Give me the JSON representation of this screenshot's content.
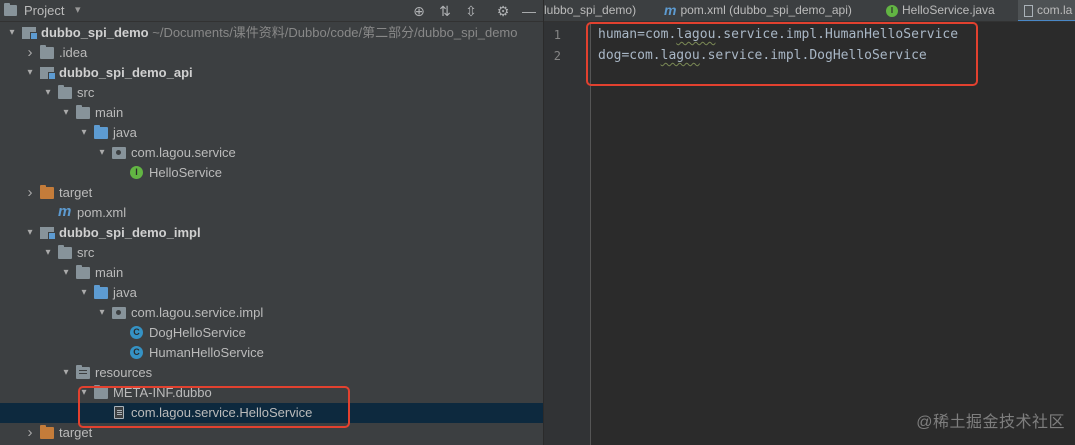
{
  "project_panel": {
    "title": "Project",
    "caret": "▾",
    "tools": [
      "⊕",
      "⇅",
      "⇳",
      "⚙",
      "—"
    ]
  },
  "tree": [
    {
      "key": "root",
      "label": "dubbo_spi_demo",
      "path": " ~/Documents/课件资料/Dubbo/code/第二部分/dubbo_spi_demo",
      "arrow": "▾",
      "icon": "module",
      "bold": true
    },
    {
      "key": "idea",
      "label": ".idea",
      "arrow": "›",
      "icon": "folder"
    },
    {
      "key": "api",
      "label": "dubbo_spi_demo_api",
      "arrow": "▾",
      "icon": "module",
      "bold": true
    },
    {
      "key": "api-src",
      "label": "src",
      "arrow": "▾",
      "icon": "folder"
    },
    {
      "key": "api-main",
      "label": "main",
      "arrow": "▾",
      "icon": "folder"
    },
    {
      "key": "api-java",
      "label": "java",
      "arrow": "▾",
      "icon": "folder-blue"
    },
    {
      "key": "api-pkg",
      "label": "com.lagou.service",
      "arrow": "▾",
      "icon": "package"
    },
    {
      "key": "api-hello",
      "label": "HelloService",
      "icon": "interface"
    },
    {
      "key": "api-target",
      "label": "target",
      "arrow": "›",
      "icon": "folder-orange"
    },
    {
      "key": "api-pom",
      "label": "pom.xml",
      "icon": "maven"
    },
    {
      "key": "impl",
      "label": "dubbo_spi_demo_impl",
      "arrow": "▾",
      "icon": "module",
      "bold": true
    },
    {
      "key": "impl-src",
      "label": "src",
      "arrow": "▾",
      "icon": "folder"
    },
    {
      "key": "impl-main",
      "label": "main",
      "arrow": "▾",
      "icon": "folder"
    },
    {
      "key": "impl-java",
      "label": "java",
      "arrow": "▾",
      "icon": "folder-blue"
    },
    {
      "key": "impl-pkg",
      "label": "com.lagou.service.impl",
      "arrow": "▾",
      "icon": "package"
    },
    {
      "key": "impl-dog",
      "label": "DogHelloService",
      "icon": "class"
    },
    {
      "key": "impl-human",
      "label": "HumanHelloService",
      "icon": "class"
    },
    {
      "key": "impl-res",
      "label": "resources",
      "arrow": "▾",
      "icon": "resources"
    },
    {
      "key": "impl-meta",
      "label": "META-INF.dubbo",
      "arrow": "▾",
      "icon": "folder"
    },
    {
      "key": "impl-file",
      "label": "com.lagou.service.HelloService",
      "icon": "text-file",
      "selected": true
    },
    {
      "key": "impl-target",
      "label": "target",
      "arrow": "›",
      "icon": "folder-orange"
    }
  ],
  "tabs": [
    {
      "label": "lubbo_spi_demo)",
      "icon": ""
    },
    {
      "label": "pom.xml (dubbo_spi_demo_api)",
      "icon": "maven"
    },
    {
      "label": "HelloService.java",
      "icon": "interface"
    },
    {
      "label": "com.la",
      "icon": "text-file",
      "active": true
    }
  ],
  "editor": {
    "line_numbers": [
      "1",
      "2"
    ],
    "lines": [
      {
        "pre": "human=com.",
        "sq": "lagou",
        "post": ".service.impl.HumanHelloService"
      },
      {
        "pre": "dog=com.",
        "sq": "lagou",
        "post": ".service.impl.DogHelloService"
      }
    ]
  },
  "watermark": "@稀土掘金技术社区",
  "colors": {
    "panel_bg": "#3c3f41",
    "editor_bg": "#2b2b2b",
    "selection": "#0d293e",
    "annotation_box": "#e2412f",
    "interface_icon": "#62b543",
    "class_icon": "#3592c4"
  }
}
